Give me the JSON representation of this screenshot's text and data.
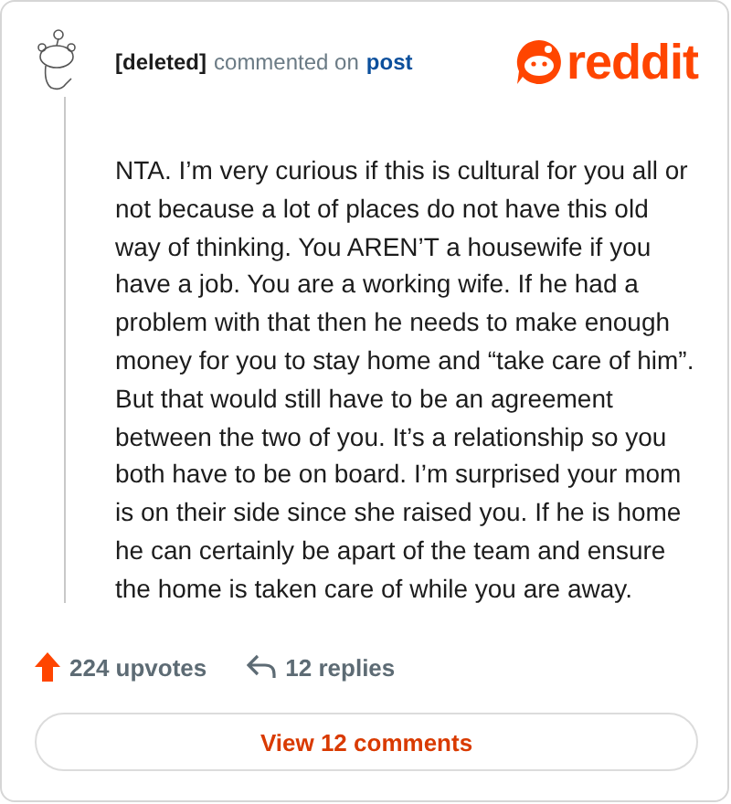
{
  "header": {
    "author": "[deleted]",
    "action": "commented on",
    "target": "post",
    "logo": "reddit"
  },
  "comment": {
    "text": "NTA. I’m very curious if this is cultural for you all or not because a lot of places do not have this old way of thinking. You AREN’T a housewife if you have a job. You are a working wife. If he had a problem with that then he needs to make enough money for you to stay home and “take care of him”. But that would still have to be an agreement between the two of you. It’s a relationship so you both have to be on board. I’m surprised your mom is on their side since she raised you. If he is home he can certainly be apart of the team and ensure the home is taken care of while you are away."
  },
  "stats": {
    "upvotes": "224 upvotes",
    "replies": "12 replies"
  },
  "button": "View 12 comments"
}
